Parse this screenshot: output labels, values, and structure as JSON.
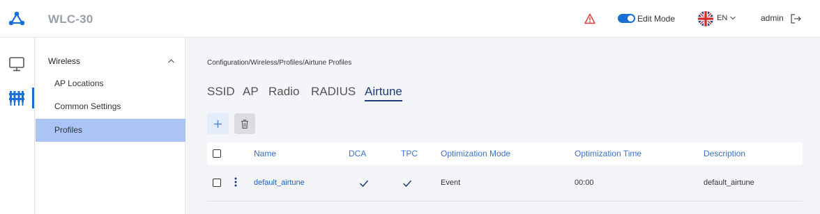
{
  "header": {
    "title": "WLC-30",
    "edit_mode_label": "Edit Mode",
    "language": "EN",
    "user": "admin",
    "accent_color": "#1a6fd4",
    "alert_color": "#e53935"
  },
  "rail": {
    "items": [
      {
        "icon": "monitor-icon"
      },
      {
        "icon": "configuration-icon",
        "active": true
      }
    ]
  },
  "nav": {
    "section": "Wireless",
    "items": [
      {
        "label": "AP Locations"
      },
      {
        "label": "Common Settings"
      },
      {
        "label": "Profiles",
        "active": true
      }
    ]
  },
  "main": {
    "breadcrumb": "Configuration/Wireless/Profiles/Airtune Profiles",
    "tabs": [
      {
        "label": "SSID"
      },
      {
        "label": "AP"
      },
      {
        "label": "Radio"
      },
      {
        "label": "RADIUS"
      },
      {
        "label": "Airtune",
        "active": true
      }
    ],
    "table": {
      "columns": [
        "Name",
        "DCA",
        "TPC",
        "Optimization Mode",
        "Optimization Time",
        "Description"
      ],
      "rows": [
        {
          "name": "default_airtune",
          "dca": true,
          "tpc": true,
          "mode": "Event",
          "time": "00:00",
          "description": "default_airtune"
        }
      ]
    }
  }
}
